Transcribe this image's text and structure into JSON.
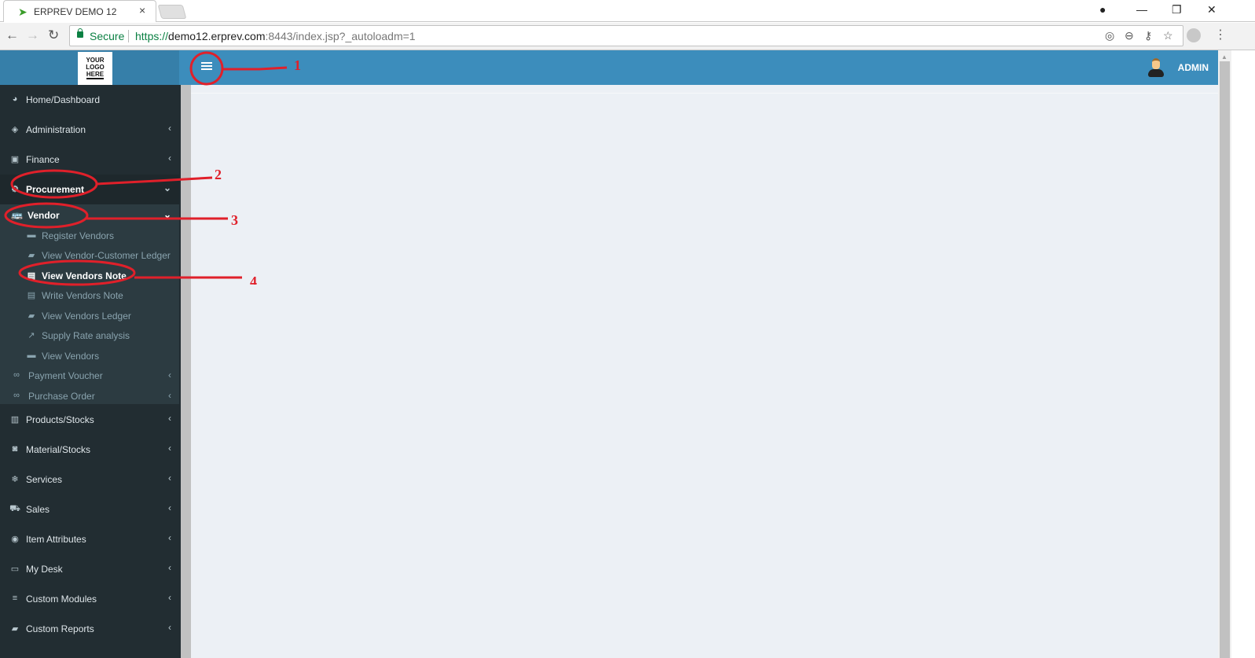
{
  "browser": {
    "tab_title": "ERPREV DEMO 12",
    "tab_close": "×",
    "secure_label": "Secure",
    "url_scheme": "https://",
    "url_host": "demo12.erprev.com",
    "url_rest": ":8443/index.jsp?_autoloadm=1",
    "icons": {
      "back": "←",
      "forward": "→",
      "reload": "↻",
      "location": "◎",
      "zoom": "⊖",
      "key": "⚷",
      "star": "☆",
      "menu": "⋮",
      "profile": "●",
      "minimize": "—",
      "restore": "❐",
      "close": "✕"
    }
  },
  "header": {
    "logo_lines": [
      "YOUR",
      "LOGO",
      "HERE"
    ],
    "user_name": "ADMIN",
    "brand_color": "#3c8dbc"
  },
  "sidebar": {
    "items_top": [
      {
        "label": "Home/Dashboard",
        "icon": "◕",
        "chevron": ""
      },
      {
        "label": "Administration",
        "icon": "◈",
        "chevron": "‹"
      },
      {
        "label": "Finance",
        "icon": "▣",
        "chevron": "‹"
      },
      {
        "label": "Procurement",
        "icon": "⚙",
        "chevron": "⌄"
      }
    ],
    "procurement_sub": [
      {
        "label": "Vendor",
        "icon": "🚌",
        "chevron": "⌄"
      },
      {
        "label": "Register Vendors",
        "icon": "▬"
      },
      {
        "label": "View Vendor-Customer Ledger",
        "icon": "▰"
      },
      {
        "label": "View Vendors Note",
        "icon": "▤"
      },
      {
        "label": "Write Vendors Note",
        "icon": "▤"
      },
      {
        "label": "View Vendors Ledger",
        "icon": "▰"
      },
      {
        "label": "Supply Rate analysis",
        "icon": "↗"
      },
      {
        "label": "View Vendors",
        "icon": "▬"
      },
      {
        "label": "Payment Voucher",
        "icon": "∞",
        "chevron": "‹"
      },
      {
        "label": "Purchase Order",
        "icon": "∞",
        "chevron": "‹"
      }
    ],
    "items_bottom": [
      {
        "label": "Products/Stocks",
        "icon": "▥",
        "chevron": "‹"
      },
      {
        "label": "Material/Stocks",
        "icon": "◙",
        "chevron": "‹"
      },
      {
        "label": "Services",
        "icon": "❄",
        "chevron": "‹"
      },
      {
        "label": "Sales",
        "icon": "⛟",
        "chevron": "‹"
      },
      {
        "label": "Item Attributes",
        "icon": "◉",
        "chevron": "‹"
      },
      {
        "label": "My Desk",
        "icon": "▭",
        "chevron": "‹"
      },
      {
        "label": "Custom Modules",
        "icon": "≡",
        "chevron": "‹"
      },
      {
        "label": "Custom Reports",
        "icon": "▰",
        "chevron": "‹"
      }
    ]
  },
  "annotations": [
    "1",
    "2",
    "3",
    "4"
  ],
  "scrollbar": {
    "up_arrow": "▲"
  }
}
